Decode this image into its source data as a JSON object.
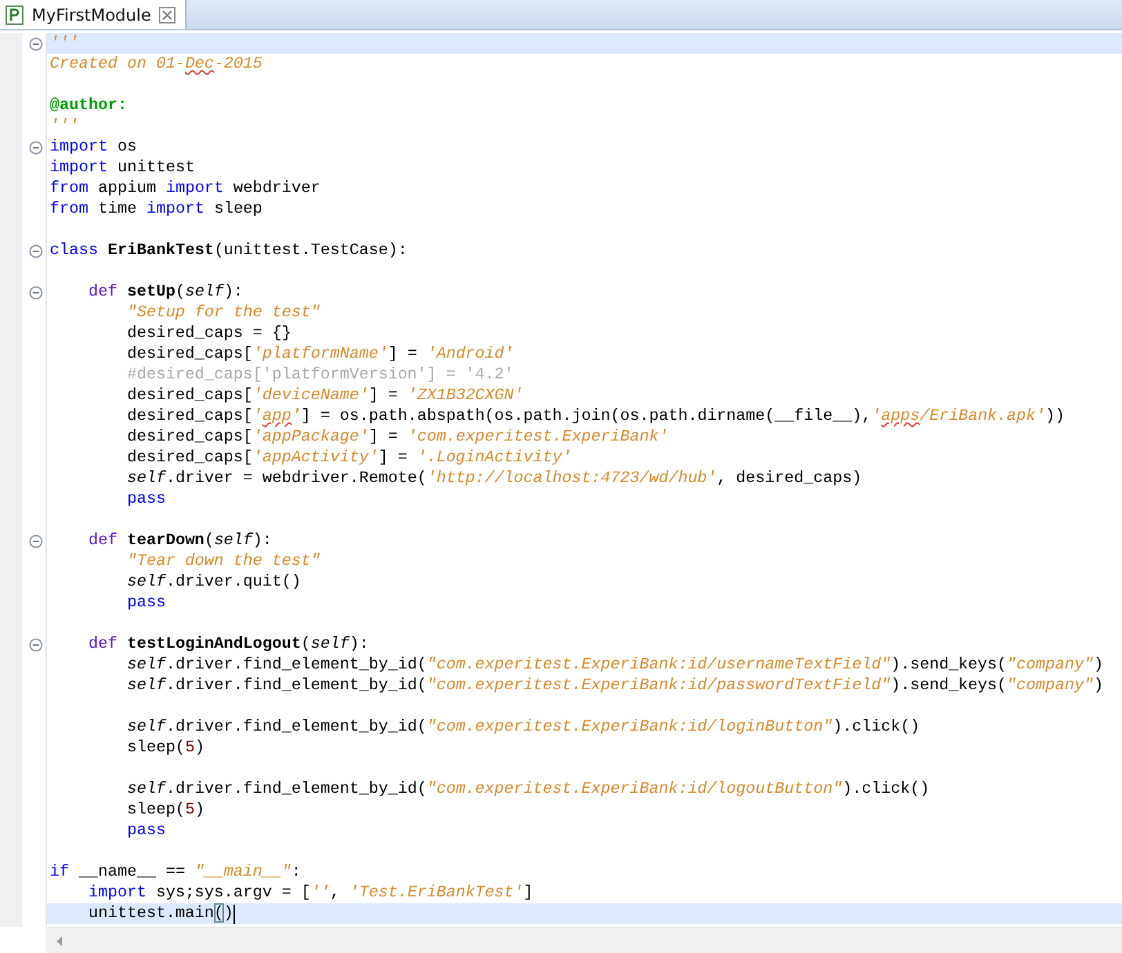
{
  "tab": {
    "title": "MyFirstModule",
    "selected": true
  },
  "lines": [
    {
      "folding": true,
      "highlighted": true,
      "tokens": [
        {
          "kind": "doc",
          "text": "'''"
        }
      ]
    },
    {
      "folding": false,
      "highlighted": false,
      "tokens": [
        {
          "kind": "doc",
          "text": "Created on 01-"
        },
        {
          "kind": "doc",
          "text": "Dec",
          "misspelled": true
        },
        {
          "kind": "doc",
          "text": "-2015"
        }
      ]
    },
    {
      "folding": false,
      "highlighted": false
    },
    {
      "folding": false,
      "highlighted": false,
      "tokens": [
        {
          "kind": "deco",
          "text": "@author:"
        }
      ]
    },
    {
      "folding": false,
      "highlighted": false,
      "tokens": [
        {
          "kind": "doc",
          "text": "'''"
        }
      ]
    },
    {
      "folding": true,
      "highlighted": false,
      "tokens": [
        {
          "kind": "kw",
          "text": "import"
        },
        {
          "kind": "p",
          "text": " os"
        }
      ]
    },
    {
      "folding": false,
      "highlighted": false,
      "tokens": [
        {
          "kind": "kw",
          "text": "import"
        },
        {
          "kind": "p",
          "text": " unittest"
        }
      ]
    },
    {
      "folding": false,
      "highlighted": false,
      "tokens": [
        {
          "kind": "kw",
          "text": "from"
        },
        {
          "kind": "p",
          "text": " appium "
        },
        {
          "kind": "kw",
          "text": "import"
        },
        {
          "kind": "p",
          "text": " webdriver"
        }
      ]
    },
    {
      "folding": false,
      "highlighted": false,
      "tokens": [
        {
          "kind": "kw",
          "text": "from"
        },
        {
          "kind": "p",
          "text": " time "
        },
        {
          "kind": "kw",
          "text": "import"
        },
        {
          "kind": "p",
          "text": " sleep"
        }
      ]
    },
    {
      "folding": false,
      "highlighted": false
    },
    {
      "folding": true,
      "highlighted": false,
      "tokens": [
        {
          "kind": "kw",
          "text": "class "
        },
        {
          "kind": "name",
          "text": "EriBankTest"
        },
        {
          "kind": "p",
          "text": "(unittest.TestCase):"
        }
      ]
    },
    {
      "folding": false,
      "highlighted": false
    },
    {
      "folding": true,
      "highlighted": false,
      "tokens": [
        {
          "kind": "def",
          "text": "    def "
        },
        {
          "kind": "name",
          "text": "setUp"
        },
        {
          "kind": "p",
          "text": "("
        },
        {
          "kind": "self",
          "text": "self"
        },
        {
          "kind": "p",
          "text": "):"
        }
      ]
    },
    {
      "folding": false,
      "highlighted": false,
      "tokens": [
        {
          "kind": "s",
          "text": "        \"Setup for the test\""
        }
      ]
    },
    {
      "folding": false,
      "highlighted": false,
      "tokens": [
        {
          "kind": "p",
          "text": "        desired_caps = {}"
        }
      ]
    },
    {
      "folding": false,
      "highlighted": false,
      "tokens": [
        {
          "kind": "p",
          "text": "        desired_caps["
        },
        {
          "kind": "s",
          "text": "'platformName'"
        },
        {
          "kind": "p",
          "text": "] = "
        },
        {
          "kind": "s",
          "text": "'Android'"
        }
      ]
    },
    {
      "folding": false,
      "highlighted": false,
      "tokens": [
        {
          "kind": "c",
          "text": "        #desired_caps['platformVersion'] = '4.2'"
        }
      ]
    },
    {
      "folding": false,
      "highlighted": false,
      "tokens": [
        {
          "kind": "p",
          "text": "        desired_caps["
        },
        {
          "kind": "s",
          "text": "'deviceName'"
        },
        {
          "kind": "p",
          "text": "] = "
        },
        {
          "kind": "s",
          "text": "'ZX1B32CXGN'"
        }
      ]
    },
    {
      "folding": false,
      "highlighted": false,
      "tokens": [
        {
          "kind": "p",
          "text": "        desired_caps["
        },
        {
          "kind": "s",
          "text": "'"
        },
        {
          "kind": "s",
          "text": "app",
          "misspelled": true
        },
        {
          "kind": "s",
          "text": "'"
        },
        {
          "kind": "p",
          "text": "] = os.path.abspath(os.path.join(os.path.dirname(__file__),"
        },
        {
          "kind": "s",
          "text": "'"
        },
        {
          "kind": "s",
          "text": "apps",
          "misspelled": true
        },
        {
          "kind": "s",
          "text": "/EriBank.apk'"
        },
        {
          "kind": "p",
          "text": "))"
        }
      ]
    },
    {
      "folding": false,
      "highlighted": false,
      "tokens": [
        {
          "kind": "p",
          "text": "        desired_caps["
        },
        {
          "kind": "s",
          "text": "'appPackage'"
        },
        {
          "kind": "p",
          "text": "] = "
        },
        {
          "kind": "s",
          "text": "'com.experitest.ExperiBank'"
        }
      ]
    },
    {
      "folding": false,
      "highlighted": false,
      "tokens": [
        {
          "kind": "p",
          "text": "        desired_caps["
        },
        {
          "kind": "s",
          "text": "'appActivity'"
        },
        {
          "kind": "p",
          "text": "] = "
        },
        {
          "kind": "s",
          "text": "'.LoginActivity'"
        }
      ]
    },
    {
      "folding": false,
      "highlighted": false,
      "tokens": [
        {
          "kind": "self",
          "text": "        self"
        },
        {
          "kind": "p",
          "text": ".driver = webdriver.Remote("
        },
        {
          "kind": "s",
          "text": "'http://localhost:4723/wd/hub'"
        },
        {
          "kind": "p",
          "text": ", desired_caps)"
        }
      ]
    },
    {
      "folding": false,
      "highlighted": false,
      "tokens": [
        {
          "kind": "kw",
          "text": "        pass"
        }
      ]
    },
    {
      "folding": false,
      "highlighted": false
    },
    {
      "folding": true,
      "highlighted": false,
      "tokens": [
        {
          "kind": "def",
          "text": "    def "
        },
        {
          "kind": "name",
          "text": "tearDown"
        },
        {
          "kind": "p",
          "text": "("
        },
        {
          "kind": "self",
          "text": "self"
        },
        {
          "kind": "p",
          "text": "):"
        }
      ]
    },
    {
      "folding": false,
      "highlighted": false,
      "tokens": [
        {
          "kind": "s",
          "text": "        \"Tear down the test\""
        }
      ]
    },
    {
      "folding": false,
      "highlighted": false,
      "tokens": [
        {
          "kind": "self",
          "text": "        self"
        },
        {
          "kind": "p",
          "text": ".driver.quit()"
        }
      ]
    },
    {
      "folding": false,
      "highlighted": false,
      "tokens": [
        {
          "kind": "kw",
          "text": "        pass"
        }
      ]
    },
    {
      "folding": false,
      "highlighted": false
    },
    {
      "folding": true,
      "highlighted": false,
      "tokens": [
        {
          "kind": "def",
          "text": "    def "
        },
        {
          "kind": "name",
          "text": "testLoginAndLogout"
        },
        {
          "kind": "p",
          "text": "("
        },
        {
          "kind": "self",
          "text": "self"
        },
        {
          "kind": "p",
          "text": "):"
        }
      ]
    },
    {
      "folding": false,
      "highlighted": false,
      "tokens": [
        {
          "kind": "self",
          "text": "        self"
        },
        {
          "kind": "p",
          "text": ".driver.find_element_by_id("
        },
        {
          "kind": "s",
          "text": "\"com.experitest.ExperiBank:id/usernameTextField\""
        },
        {
          "kind": "p",
          "text": ").send_keys("
        },
        {
          "kind": "s",
          "text": "\"company\""
        },
        {
          "kind": "p",
          "text": ")"
        }
      ]
    },
    {
      "folding": false,
      "highlighted": false,
      "tokens": [
        {
          "kind": "self",
          "text": "        self"
        },
        {
          "kind": "p",
          "text": ".driver.find_element_by_id("
        },
        {
          "kind": "s",
          "text": "\"com.experitest.ExperiBank:id/passwordTextField\""
        },
        {
          "kind": "p",
          "text": ").send_keys("
        },
        {
          "kind": "s",
          "text": "\"company\""
        },
        {
          "kind": "p",
          "text": ")"
        }
      ]
    },
    {
      "folding": false,
      "highlighted": false
    },
    {
      "folding": false,
      "highlighted": false,
      "tokens": [
        {
          "kind": "self",
          "text": "        self"
        },
        {
          "kind": "p",
          "text": ".driver.find_element_by_id("
        },
        {
          "kind": "s",
          "text": "\"com.experitest.ExperiBank:id/loginButton\""
        },
        {
          "kind": "p",
          "text": ").click()"
        }
      ]
    },
    {
      "folding": false,
      "highlighted": false,
      "tokens": [
        {
          "kind": "p",
          "text": "        sleep("
        },
        {
          "kind": "num",
          "text": "5"
        },
        {
          "kind": "p",
          "text": ")"
        }
      ]
    },
    {
      "folding": false,
      "highlighted": false
    },
    {
      "folding": false,
      "highlighted": false,
      "tokens": [
        {
          "kind": "self",
          "text": "        self"
        },
        {
          "kind": "p",
          "text": ".driver.find_element_by_id("
        },
        {
          "kind": "s",
          "text": "\"com.experitest.ExperiBank:id/logoutButton\""
        },
        {
          "kind": "p",
          "text": ").click()"
        }
      ]
    },
    {
      "folding": false,
      "highlighted": false,
      "tokens": [
        {
          "kind": "p",
          "text": "        sleep("
        },
        {
          "kind": "num",
          "text": "5"
        },
        {
          "kind": "p",
          "text": ")"
        }
      ]
    },
    {
      "folding": false,
      "highlighted": false,
      "tokens": [
        {
          "kind": "kw",
          "text": "        pass"
        }
      ]
    },
    {
      "folding": false,
      "highlighted": false
    },
    {
      "folding": false,
      "highlighted": false,
      "tokens": [
        {
          "kind": "kw",
          "text": "if"
        },
        {
          "kind": "p",
          "text": " __name__ == "
        },
        {
          "kind": "s",
          "text": "\"__main__\""
        },
        {
          "kind": "p",
          "text": ":"
        }
      ]
    },
    {
      "folding": false,
      "highlighted": false,
      "tokens": [
        {
          "kind": "kw",
          "text": "    import"
        },
        {
          "kind": "p",
          "text": " sys;sys.argv = ["
        },
        {
          "kind": "s",
          "text": "''"
        },
        {
          "kind": "p",
          "text": ", "
        },
        {
          "kind": "s",
          "text": "'Test.EriBankTest'"
        },
        {
          "kind": "p",
          "text": "]"
        }
      ]
    },
    {
      "folding": false,
      "highlighted": true,
      "cursor": true,
      "tokens": [
        {
          "kind": "p",
          "text": "    unittest.main"
        },
        {
          "kind": "match",
          "text": "("
        },
        {
          "kind": "p",
          "text": ")"
        }
      ]
    }
  ]
}
